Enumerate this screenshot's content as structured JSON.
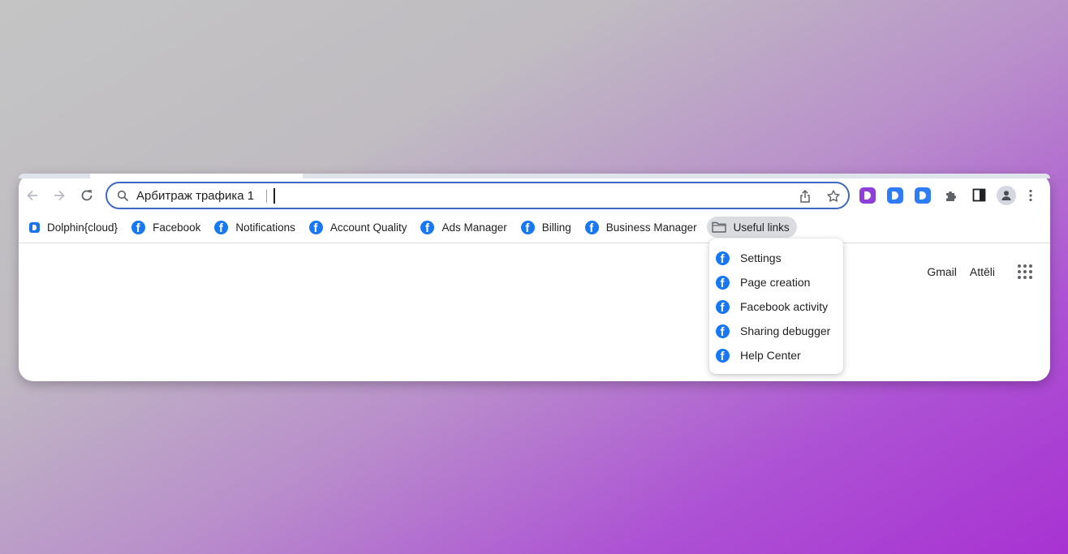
{
  "omnibox": {
    "query": "Арбитраж трафика 1"
  },
  "extensions": [
    {
      "name": "dolphin-anty-purple-icon",
      "color": "#8e3fd8"
    },
    {
      "name": "dolphin-anty-blue-icon",
      "color": "#2f7cf6"
    },
    {
      "name": "dolphin-cloud-blue-icon",
      "color": "#2f7cf6"
    }
  ],
  "bookmarks": [
    {
      "label": "Dolphin{cloud}",
      "icon": "dolphin-icon"
    },
    {
      "label": "Facebook",
      "icon": "facebook-icon"
    },
    {
      "label": "Notifications",
      "icon": "facebook-icon"
    },
    {
      "label": "Account Quality",
      "icon": "facebook-icon"
    },
    {
      "label": "Ads Manager",
      "icon": "facebook-icon"
    },
    {
      "label": "Billing",
      "icon": "facebook-icon"
    },
    {
      "label": "Business Manager",
      "icon": "facebook-icon"
    },
    {
      "label": "Useful links",
      "icon": "folder-icon"
    }
  ],
  "dropdown": {
    "items": [
      {
        "label": "Settings"
      },
      {
        "label": "Page creation"
      },
      {
        "label": "Facebook activity"
      },
      {
        "label": "Sharing debugger"
      },
      {
        "label": "Help Center"
      }
    ]
  },
  "google_links": {
    "gmail": "Gmail",
    "images": "Attēli"
  },
  "colors": {
    "accent": "#3c68c2",
    "facebook": "#1877f2"
  }
}
